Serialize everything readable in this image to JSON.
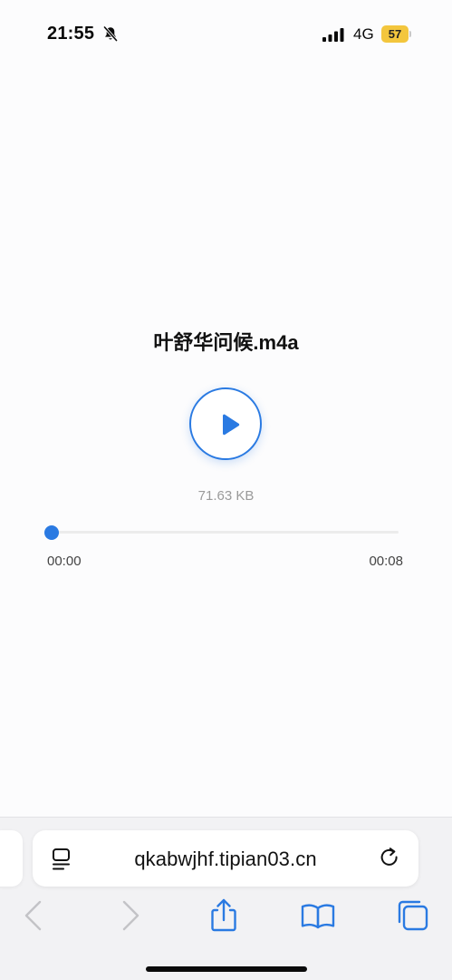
{
  "status_bar": {
    "time": "21:55",
    "network": "4G",
    "battery_level": "57",
    "battery_color": "#f3c63d",
    "icons": [
      "bell-slash-icon",
      "signal-icon"
    ]
  },
  "player": {
    "file_name": "叶舒华问候.m4a",
    "file_size": "71.63 KB",
    "current_time": "00:00",
    "total_time": "00:08",
    "progress": 0,
    "accent_color": "#2a7ae2",
    "play_icon": "play-icon"
  },
  "browser": {
    "url": "qkabwjhf.tipian03.cn",
    "address_icons": [
      "page-menu-icon",
      "reload-icon"
    ],
    "toolbar_icons": [
      "back-icon",
      "forward-icon",
      "share-icon",
      "bookmarks-icon",
      "tabs-icon"
    ]
  }
}
